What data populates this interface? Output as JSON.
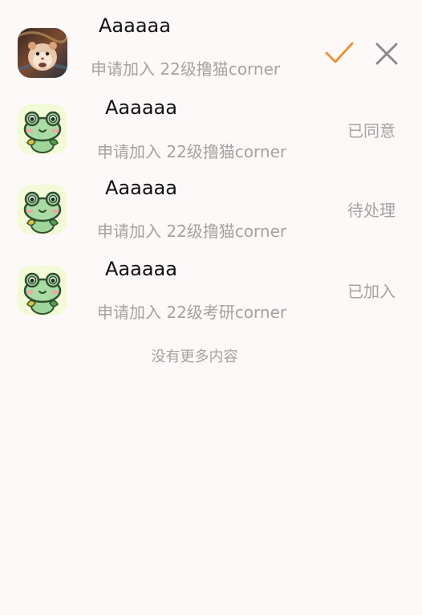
{
  "requests": [
    {
      "name": "Aaaaaa",
      "description": "申请加入 22级撸猫corner",
      "avatar": "hamster-photo",
      "status": "",
      "actions": [
        "accept-check-icon",
        "reject-x-icon"
      ]
    },
    {
      "name": "Aaaaaa",
      "description": "申请加入 22级撸猫corner",
      "avatar": "frog-avatar",
      "status": "已同意"
    },
    {
      "name": "Aaaaaa",
      "description": "申请加入 22级撸猫corner",
      "avatar": "frog-avatar",
      "status": "待处理"
    },
    {
      "name": "Aaaaaa",
      "description": "申请加入 22级考研corner",
      "avatar": "frog-avatar",
      "status": "已加入"
    }
  ],
  "footer": {
    "text": "没有更多内容"
  },
  "colors": {
    "accept": "#f0913a",
    "reject": "#8a8a8a",
    "muted_text": "#a6a2a1",
    "background": "#fdf9f8"
  }
}
